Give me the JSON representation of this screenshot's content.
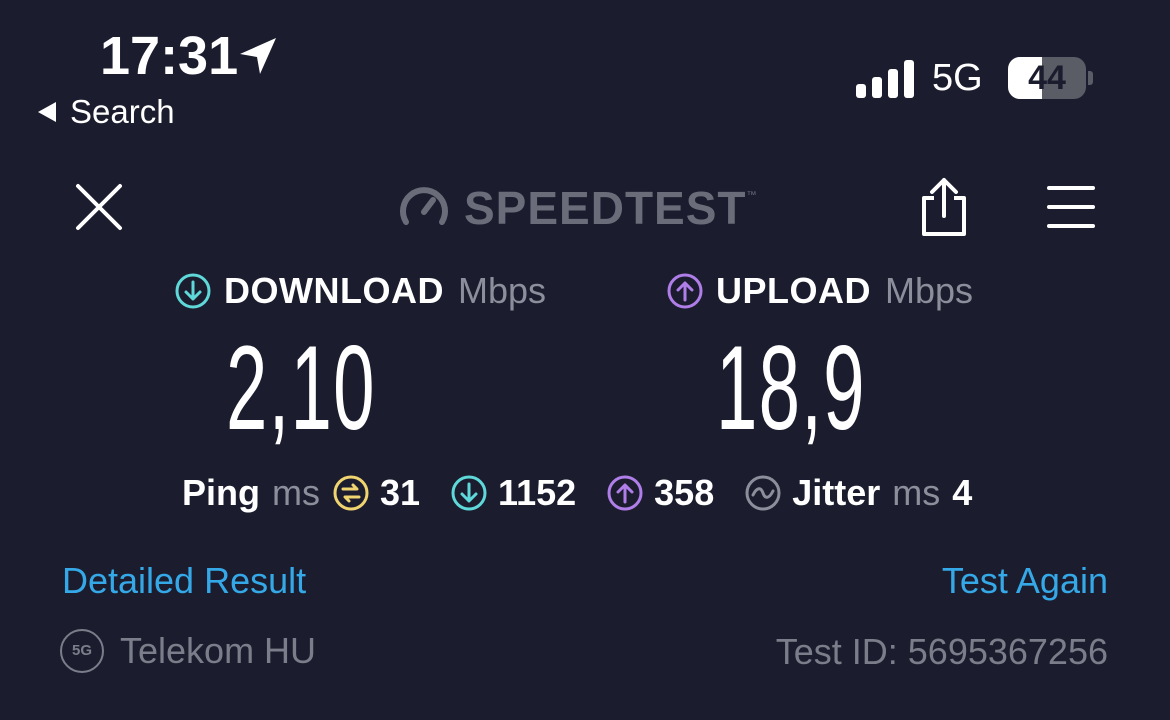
{
  "status_bar": {
    "time": "17:31",
    "back_label": "Search",
    "network": "5G",
    "battery": "44",
    "battery_level": 0.44
  },
  "header": {
    "brand": "SPEEDTEST",
    "brand_mark": "™",
    "icons": [
      "close-icon",
      "speedtest-gauge-icon",
      "share-icon",
      "menu-icon"
    ]
  },
  "download": {
    "label": "DOWNLOAD",
    "unit": "Mbps",
    "value": "2,10"
  },
  "upload": {
    "label": "UPLOAD",
    "unit": "Mbps",
    "value": "18,9"
  },
  "ping": {
    "label": "Ping",
    "unit": "ms",
    "idle": "31",
    "download": "1152",
    "upload": "358"
  },
  "jitter": {
    "label": "Jitter",
    "unit": "ms",
    "value": "4"
  },
  "actions": {
    "detailed": "Detailed Result",
    "again": "Test Again"
  },
  "footer": {
    "carrier_badge": "5G",
    "carrier": "Telekom HU",
    "test_id": "Test ID: 5695367256"
  },
  "colors": {
    "background": "#1b1d2e",
    "download_accent": "#5fd8d9",
    "upload_accent": "#b07ee8",
    "ping_accent": "#f0d470",
    "link": "#35a9e8"
  }
}
